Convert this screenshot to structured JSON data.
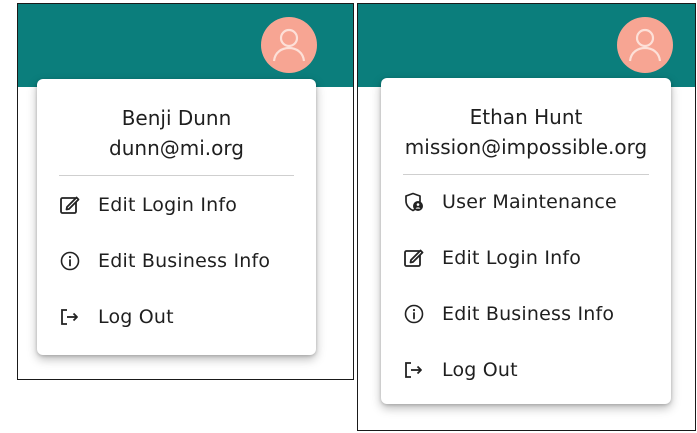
{
  "left_panel": {
    "user": {
      "name": "Benji Dunn",
      "email": "dunn@mi.org"
    },
    "menu_items": [
      {
        "label": "Edit Login Info",
        "icon": "edit-icon"
      },
      {
        "label": "Edit Business Info",
        "icon": "info-icon"
      },
      {
        "label": "Log Out",
        "icon": "logout-icon"
      }
    ]
  },
  "right_panel": {
    "user": {
      "name": "Ethan Hunt",
      "email": "mission@impossible.org"
    },
    "menu_items": [
      {
        "label": "User Maintenance",
        "icon": "user-shield-icon"
      },
      {
        "label": "Edit Login Info",
        "icon": "edit-icon"
      },
      {
        "label": "Edit Business Info",
        "icon": "info-icon"
      },
      {
        "label": "Log Out",
        "icon": "logout-icon"
      }
    ]
  },
  "colors": {
    "header": "#0b7e7c",
    "avatar_bg": "#f7a593",
    "avatar_fg": "#fbd3c8"
  }
}
